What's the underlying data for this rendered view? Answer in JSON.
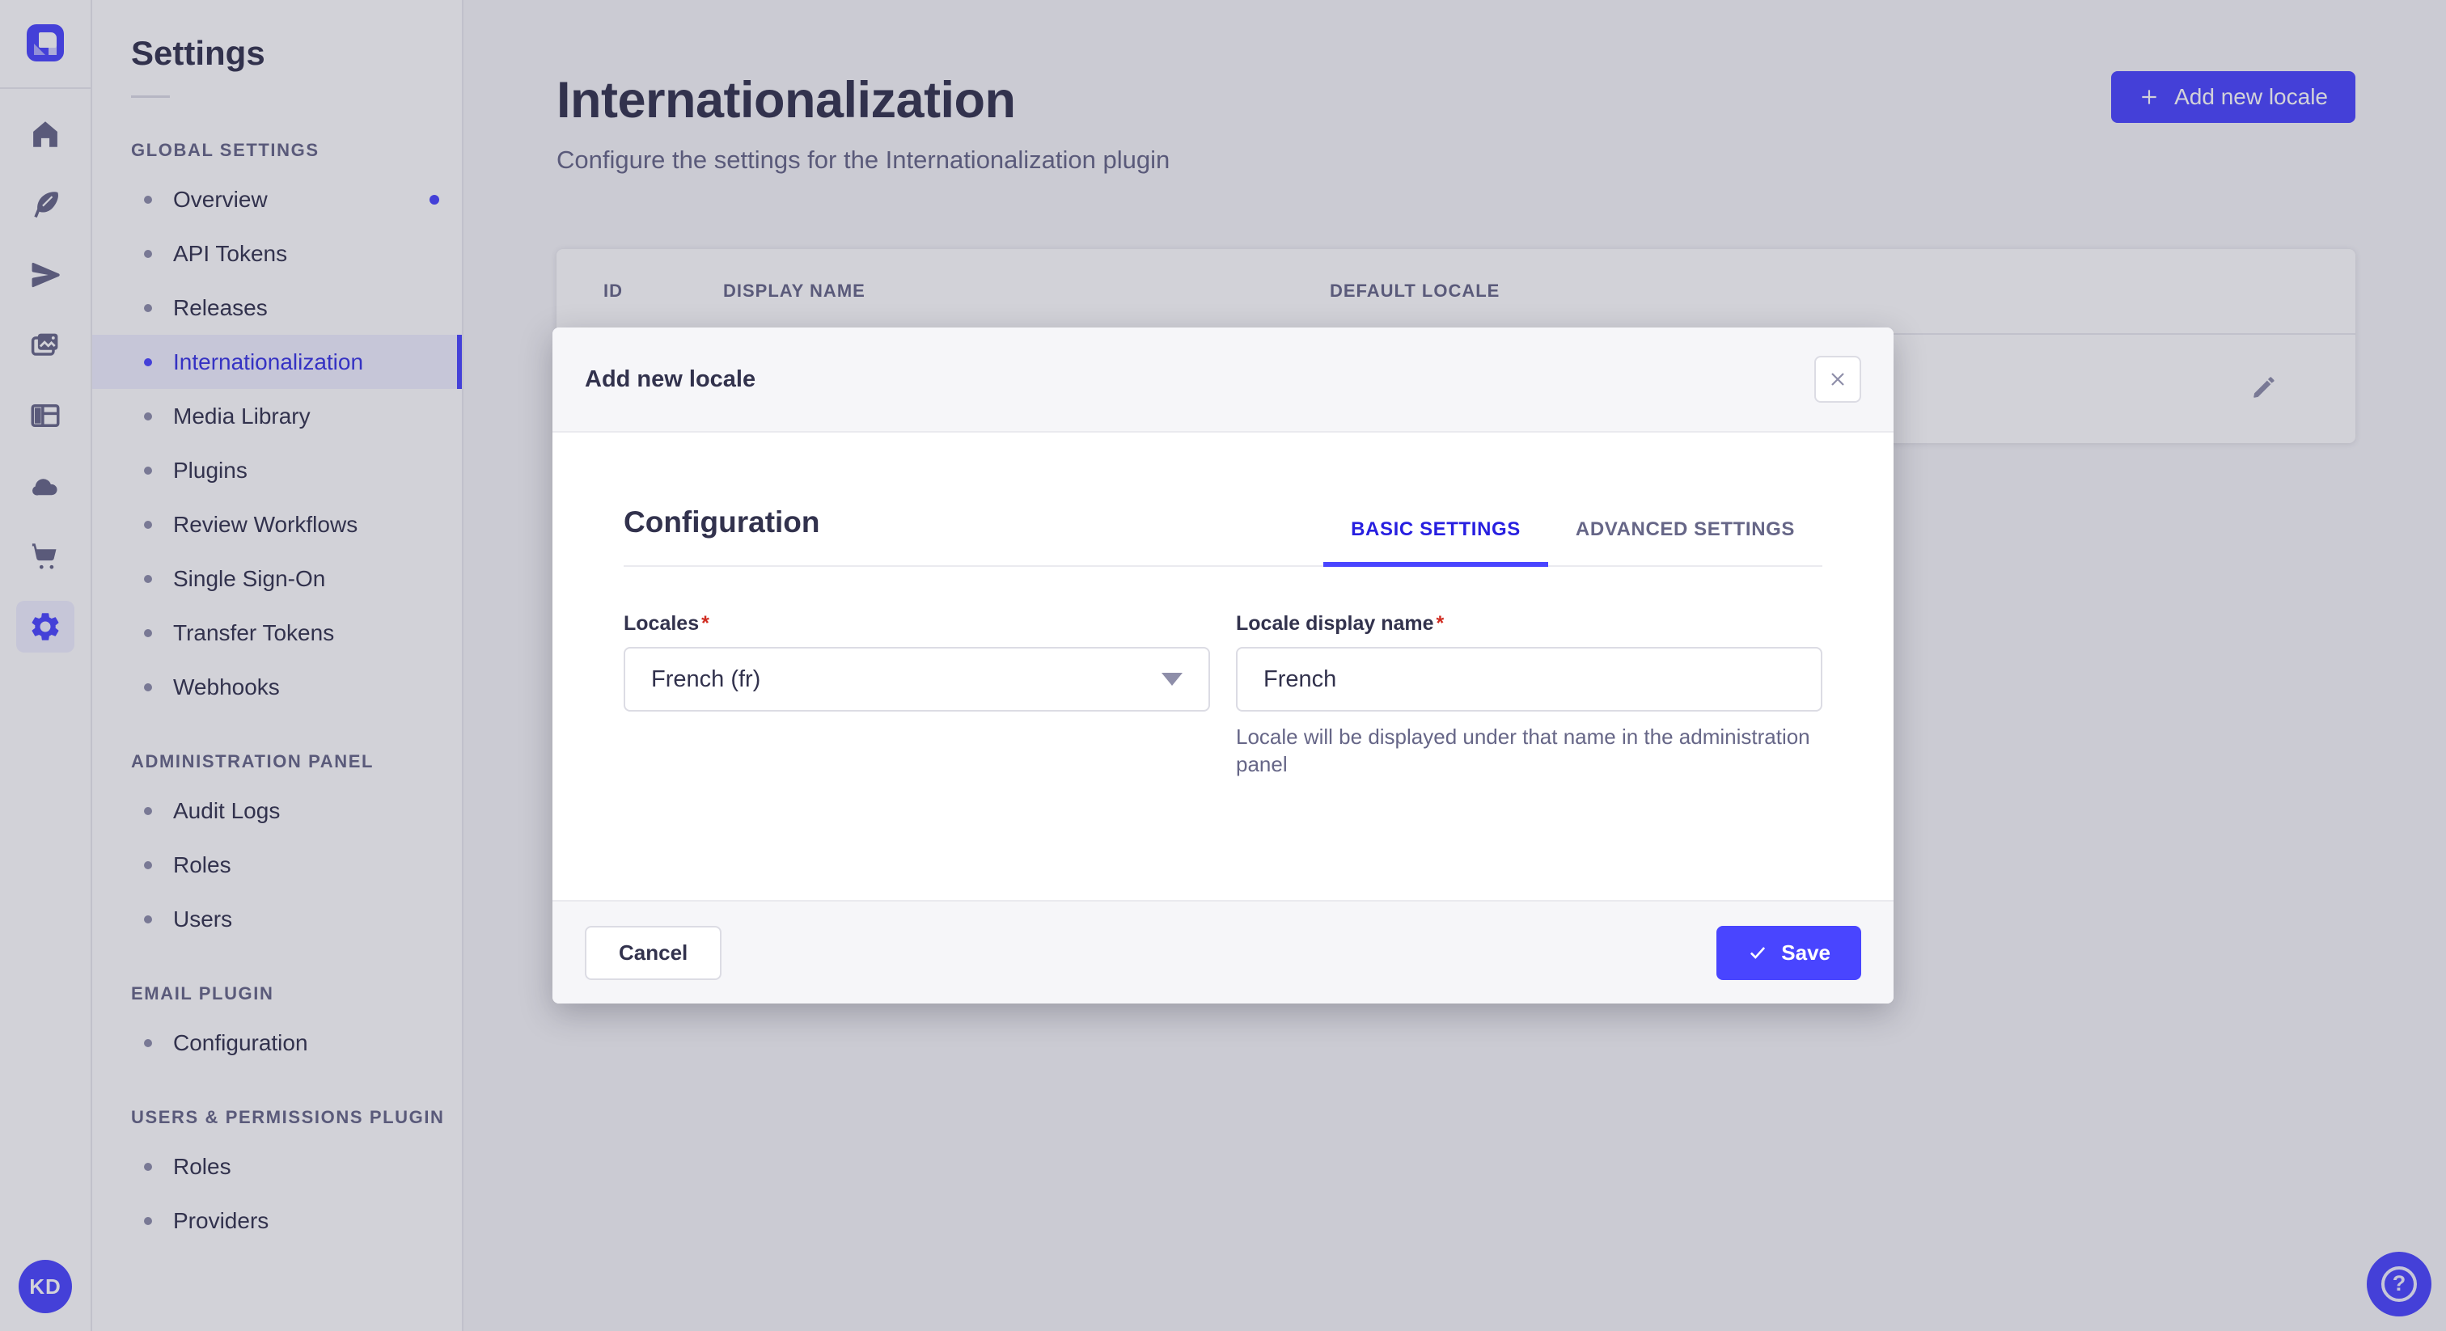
{
  "colors": {
    "primary": "#4945ff",
    "primary_dark": "#271fe0",
    "danger": "#d02b20",
    "overlay": "rgba(50,50,77,0.22)"
  },
  "rail": {
    "icons": [
      "home-icon",
      "feather-icon",
      "paper-plane-icon",
      "media-icon",
      "layout-icon",
      "cloud-icon",
      "cart-icon",
      "gear-icon"
    ],
    "user_initials": "KD",
    "help_glyph": "?"
  },
  "sidebar": {
    "title": "Settings",
    "sections": [
      {
        "label": "GLOBAL SETTINGS",
        "items": [
          {
            "label": "Overview",
            "active": false,
            "dot": true
          },
          {
            "label": "API Tokens",
            "active": false
          },
          {
            "label": "Releases",
            "active": false
          },
          {
            "label": "Internationalization",
            "active": true
          },
          {
            "label": "Media Library",
            "active": false
          },
          {
            "label": "Plugins",
            "active": false
          },
          {
            "label": "Review Workflows",
            "active": false
          },
          {
            "label": "Single Sign-On",
            "active": false
          },
          {
            "label": "Transfer Tokens",
            "active": false
          },
          {
            "label": "Webhooks",
            "active": false
          }
        ]
      },
      {
        "label": "ADMINISTRATION PANEL",
        "items": [
          {
            "label": "Audit Logs",
            "active": false
          },
          {
            "label": "Roles",
            "active": false
          },
          {
            "label": "Users",
            "active": false
          }
        ]
      },
      {
        "label": "EMAIL PLUGIN",
        "items": [
          {
            "label": "Configuration",
            "active": false
          }
        ]
      },
      {
        "label": "USERS & PERMISSIONS PLUGIN",
        "items": [
          {
            "label": "Roles",
            "active": false
          },
          {
            "label": "Providers",
            "active": false
          }
        ]
      }
    ]
  },
  "header": {
    "title": "Internationalization",
    "subtitle": "Configure the settings for the Internationalization plugin",
    "add_button_label": "Add new locale"
  },
  "table": {
    "columns": [
      "ID",
      "DISPLAY NAME",
      "DEFAULT LOCALE"
    ]
  },
  "modal": {
    "title": "Add new locale",
    "section_title": "Configuration",
    "required_mark": "*",
    "tabs": [
      {
        "label": "BASIC SETTINGS",
        "active": true
      },
      {
        "label": "ADVANCED SETTINGS",
        "active": false
      }
    ],
    "fields": {
      "locales": {
        "label": "Locales",
        "value": "French (fr)"
      },
      "display_name": {
        "label": "Locale display name",
        "value": "French",
        "help": "Locale will be displayed under that name in the administration panel"
      }
    },
    "cancel_label": "Cancel",
    "save_label": "Save"
  }
}
